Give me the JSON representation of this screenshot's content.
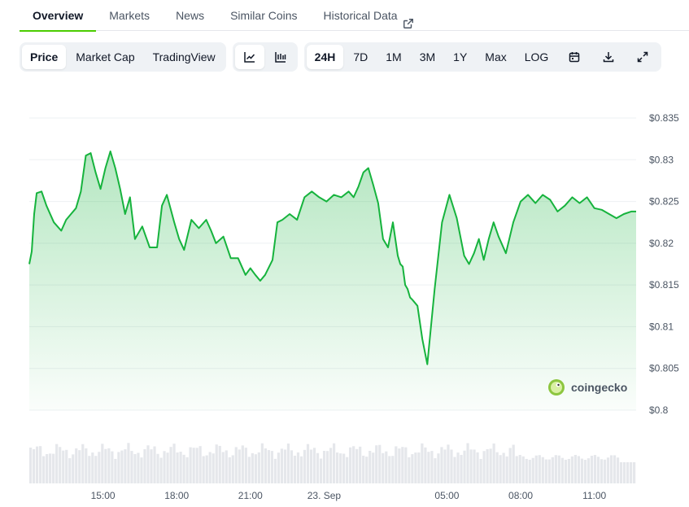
{
  "tabs": [
    {
      "label": "Overview",
      "active": true
    },
    {
      "label": "Markets"
    },
    {
      "label": "News"
    },
    {
      "label": "Similar Coins"
    },
    {
      "label": "Historical Data",
      "external": true
    }
  ],
  "toolbar": {
    "metric_tabs": [
      "Price",
      "Market Cap",
      "TradingView"
    ],
    "active_metric": "Price",
    "chart_style_icons": [
      "line-chart-icon",
      "candlestick-icon"
    ],
    "ranges": [
      "24H",
      "7D",
      "1M",
      "3M",
      "1Y",
      "Max",
      "LOG"
    ],
    "active_range": "24H",
    "action_icons": [
      "calendar-icon",
      "download-icon",
      "fullscreen-icon"
    ]
  },
  "watermark": "coingecko",
  "colors": {
    "line": "#16b33d",
    "accent": "#4bcc00",
    "volume": "#e5e7eb"
  },
  "chart_data": {
    "type": "line",
    "title": "",
    "xlabel": "",
    "ylabel": "",
    "ylim": [
      0.8,
      0.835
    ],
    "grid": true,
    "y_ticks": [
      "$0.835",
      "$0.83",
      "$0.825",
      "$0.82",
      "$0.815",
      "$0.81",
      "$0.805",
      "$0.8"
    ],
    "y_tick_values": [
      0.835,
      0.83,
      0.825,
      0.82,
      0.815,
      0.81,
      0.805,
      0.8
    ],
    "x_ticks": [
      "15:00",
      "18:00",
      "21:00",
      "23. Sep",
      "05:00",
      "08:00",
      "11:00"
    ],
    "x_tick_hours": [
      15,
      18,
      21,
      24,
      29,
      32,
      35
    ],
    "x_range_hours": [
      12,
      36.7
    ],
    "series": [
      {
        "x": [
          12.0,
          12.1,
          12.2,
          12.3,
          12.5,
          12.7,
          13.0,
          13.3,
          13.5,
          13.7,
          13.9,
          14.1,
          14.3,
          14.5,
          14.7,
          14.9,
          15.1,
          15.3,
          15.5,
          15.7,
          15.9,
          16.1,
          16.3,
          16.6,
          16.9,
          17.2,
          17.4,
          17.6,
          17.9,
          18.1,
          18.3,
          18.6,
          18.9,
          19.2,
          19.4,
          19.6,
          19.9,
          20.2,
          20.5,
          20.8,
          21.0,
          21.2,
          21.4,
          21.6,
          21.9,
          22.1,
          22.3,
          22.6,
          22.9,
          23.2,
          23.5,
          23.8,
          24.1,
          24.4,
          24.7,
          25.0,
          25.2,
          25.4,
          25.6,
          25.8,
          26.0,
          26.2,
          26.4,
          26.6,
          26.8,
          26.9,
          27.0,
          27.1,
          27.2,
          27.3,
          27.4,
          27.5,
          27.6,
          27.8,
          28.0,
          28.2,
          28.5,
          28.8,
          29.1,
          29.4,
          29.7,
          29.9,
          30.1,
          30.3,
          30.5,
          30.7,
          30.9,
          31.1,
          31.4,
          31.7,
          32.0,
          32.3,
          32.6,
          32.9,
          33.2,
          33.5,
          33.8,
          34.1,
          34.4,
          34.7,
          35.0,
          35.3,
          35.6,
          35.9,
          36.2,
          36.5,
          36.7
        ],
        "values": [
          0.8175,
          0.819,
          0.8235,
          0.826,
          0.8262,
          0.8245,
          0.8225,
          0.8215,
          0.8228,
          0.8235,
          0.8242,
          0.8262,
          0.8305,
          0.8308,
          0.8285,
          0.8265,
          0.829,
          0.831,
          0.829,
          0.8265,
          0.8235,
          0.8255,
          0.8205,
          0.822,
          0.8195,
          0.8195,
          0.8245,
          0.8258,
          0.8225,
          0.8205,
          0.8192,
          0.8228,
          0.8218,
          0.8228,
          0.8215,
          0.82,
          0.8208,
          0.8182,
          0.8182,
          0.8162,
          0.817,
          0.8162,
          0.8155,
          0.8162,
          0.818,
          0.8225,
          0.8228,
          0.8235,
          0.8228,
          0.8255,
          0.8262,
          0.8255,
          0.825,
          0.8258,
          0.8255,
          0.8262,
          0.8255,
          0.8268,
          0.8285,
          0.829,
          0.827,
          0.8248,
          0.8205,
          0.8195,
          0.8225,
          0.8205,
          0.8185,
          0.8175,
          0.8172,
          0.815,
          0.8145,
          0.8135,
          0.8132,
          0.8125,
          0.8085,
          0.8055,
          0.8145,
          0.8225,
          0.8258,
          0.823,
          0.8185,
          0.8175,
          0.8188,
          0.8205,
          0.818,
          0.8205,
          0.8225,
          0.8208,
          0.8188,
          0.8225,
          0.825,
          0.8258,
          0.8248,
          0.8258,
          0.8252,
          0.8238,
          0.8245,
          0.8255,
          0.8248,
          0.8255,
          0.8242,
          0.824,
          0.8235,
          0.823,
          0.8235,
          0.8238,
          0.8238
        ]
      }
    ]
  }
}
